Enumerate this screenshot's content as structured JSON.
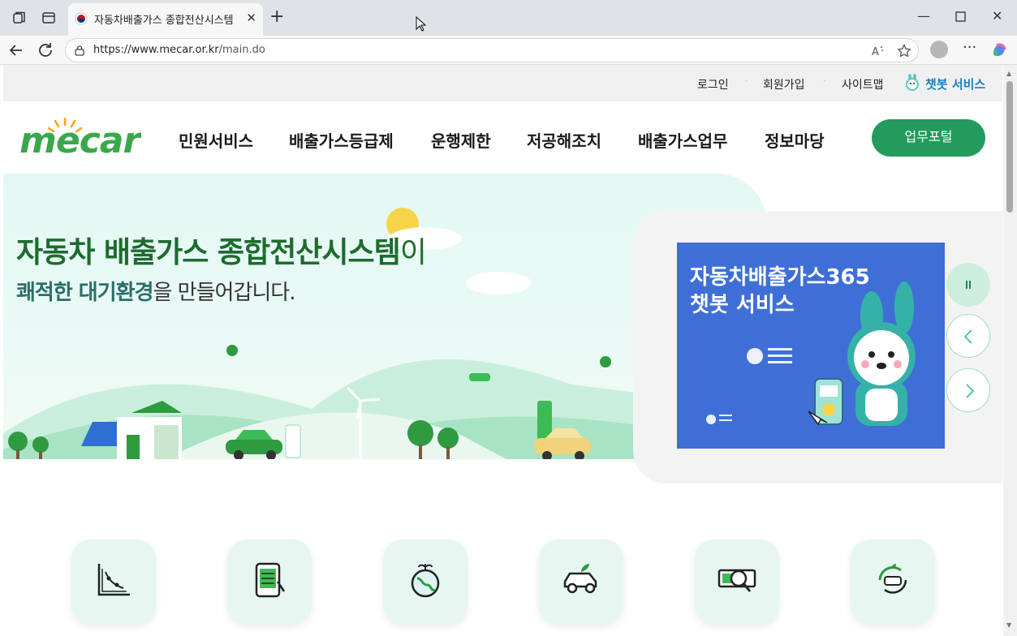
{
  "browser": {
    "tab_title": "자동차배출가스 종합전산시스템",
    "url_host": "https://www.mecar.or.kr",
    "url_path": "/main.do"
  },
  "util_nav": {
    "login": "로그인",
    "signup": "회원가입",
    "sitemap": "사이트맵",
    "chatbot": "챗봇 서비스"
  },
  "logo": {
    "text": "mecar"
  },
  "gnb": [
    "민원서비스",
    "배출가스등급제",
    "운행제한",
    "저공해조치",
    "배출가스업무",
    "정보마당"
  ],
  "portal_button": "업무포털",
  "hero": {
    "title_em": "자동차 배출가스 종합전산시스템",
    "title_rest": "이",
    "sub_em": "쾌적한 대기환경",
    "sub_rest": "을 만들어갑니다."
  },
  "banner": {
    "line1": "자동차배출가스365",
    "line2": "챗봇 서비스"
  },
  "slider_controls": {
    "pause_icon": "pause-icon",
    "prev_icon": "chevron-left-icon",
    "next_icon": "chevron-right-icon"
  },
  "quick_menu_icons": [
    "chart-icon",
    "tablet-form-icon",
    "earth-sprout-icon",
    "eco-car-icon",
    "search-inspection-icon",
    "recycle-car-icon"
  ],
  "colors": {
    "brand_green": "#239b5c",
    "hero_title": "#1e6b2e",
    "chatbot_blue": "#1a7fc0",
    "banner_blue": "#3f6fd6"
  }
}
